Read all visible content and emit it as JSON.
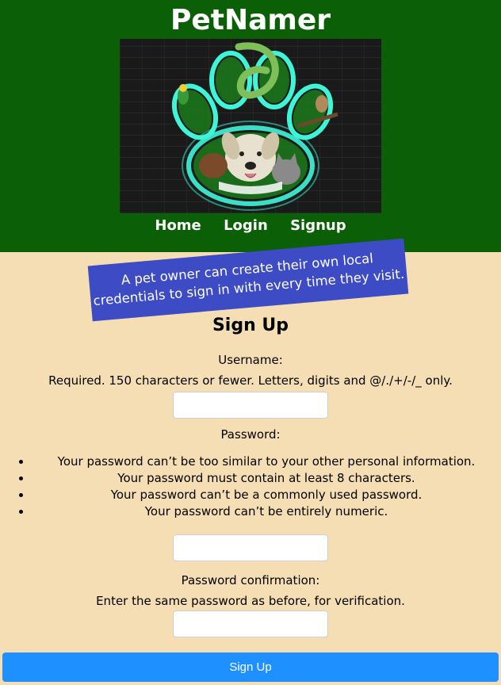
{
  "site": {
    "title": "PetNamer"
  },
  "hero": {
    "alt": "Neon paw print with a dog, cat, bird and other pets"
  },
  "nav": {
    "items": [
      {
        "label": "Home"
      },
      {
        "label": "Login"
      },
      {
        "label": "Signup"
      }
    ]
  },
  "banner": {
    "line1": "A pet owner can create their own local",
    "line2": "credentials to sign in with every time they visit."
  },
  "form": {
    "title": "Sign Up",
    "username_label": "Username:",
    "username_help": "Required. 150 characters or fewer. Letters, digits and @/./+/-/_ only.",
    "username_value": "",
    "password_label": "Password:",
    "password_rules": [
      "Your password can’t be too similar to your other personal information.",
      "Your password must contain at least 8 characters.",
      "Your password can’t be a commonly used password.",
      "Your password can’t be entirely numeric."
    ],
    "password_value": "",
    "confirm_label": "Password confirmation:",
    "confirm_help": "Enter the same password as before, for verification.",
    "confirm_value": "",
    "submit_label": "Sign Up"
  },
  "colors": {
    "header_bg": "#0a5f07",
    "page_bg": "#f5deb3",
    "banner_bg": "#3d4bc4",
    "button_bg": "#1e90ff",
    "neon": "#3ff5d8"
  }
}
